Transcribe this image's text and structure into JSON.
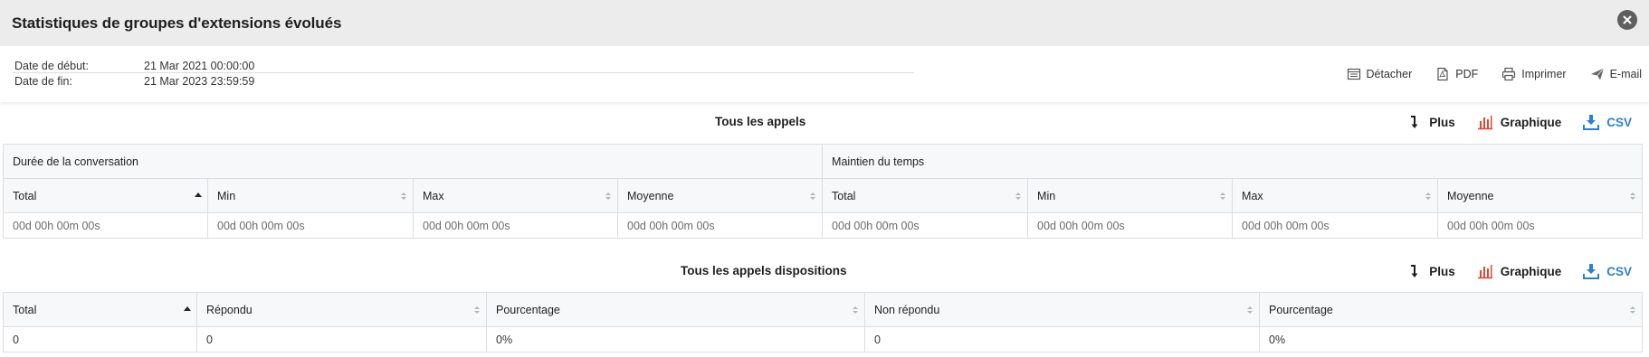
{
  "window": {
    "title": "Statistiques de groupes d'extensions évolués",
    "close_icon": "close-circle-icon"
  },
  "dates": {
    "start_label": "Date de début:",
    "start_value": "21 Mar 2021 00:00:00",
    "end_label": "Date de fin:",
    "end_value": "21 Mar 2023 23:59:59"
  },
  "actions": {
    "detach": "Détacher",
    "pdf": "PDF",
    "print": "Imprimer",
    "email": "E-mail"
  },
  "section1": {
    "title": "Tous les appels",
    "more": "Plus",
    "chart": "Graphique",
    "csv": "CSV",
    "groups": [
      "Durée de la conversation",
      "Maintien du temps"
    ],
    "columns": [
      "Total",
      "Min",
      "Max",
      "Moyenne",
      "Total",
      "Min",
      "Max",
      "Moyenne"
    ],
    "row": [
      "00d 00h 00m 00s",
      "00d 00h 00m 00s",
      "00d 00h 00m 00s",
      "00d 00h 00m 00s",
      "00d 00h 00m 00s",
      "00d 00h 00m 00s",
      "00d 00h 00m 00s",
      "00d 00h 00m 00s"
    ]
  },
  "section2": {
    "title": "Tous les appels dispositions",
    "more": "Plus",
    "chart": "Graphique",
    "csv": "CSV",
    "columns": [
      "Total",
      "Répondu",
      "Pourcentage",
      "Non répondu",
      "Pourcentage"
    ],
    "row": [
      "0",
      "0",
      "0%",
      "0",
      "0%"
    ]
  },
  "colors": {
    "title_bg": "#ececec",
    "chart_icon": "#e0452e",
    "csv_link": "#2b7fd9"
  }
}
